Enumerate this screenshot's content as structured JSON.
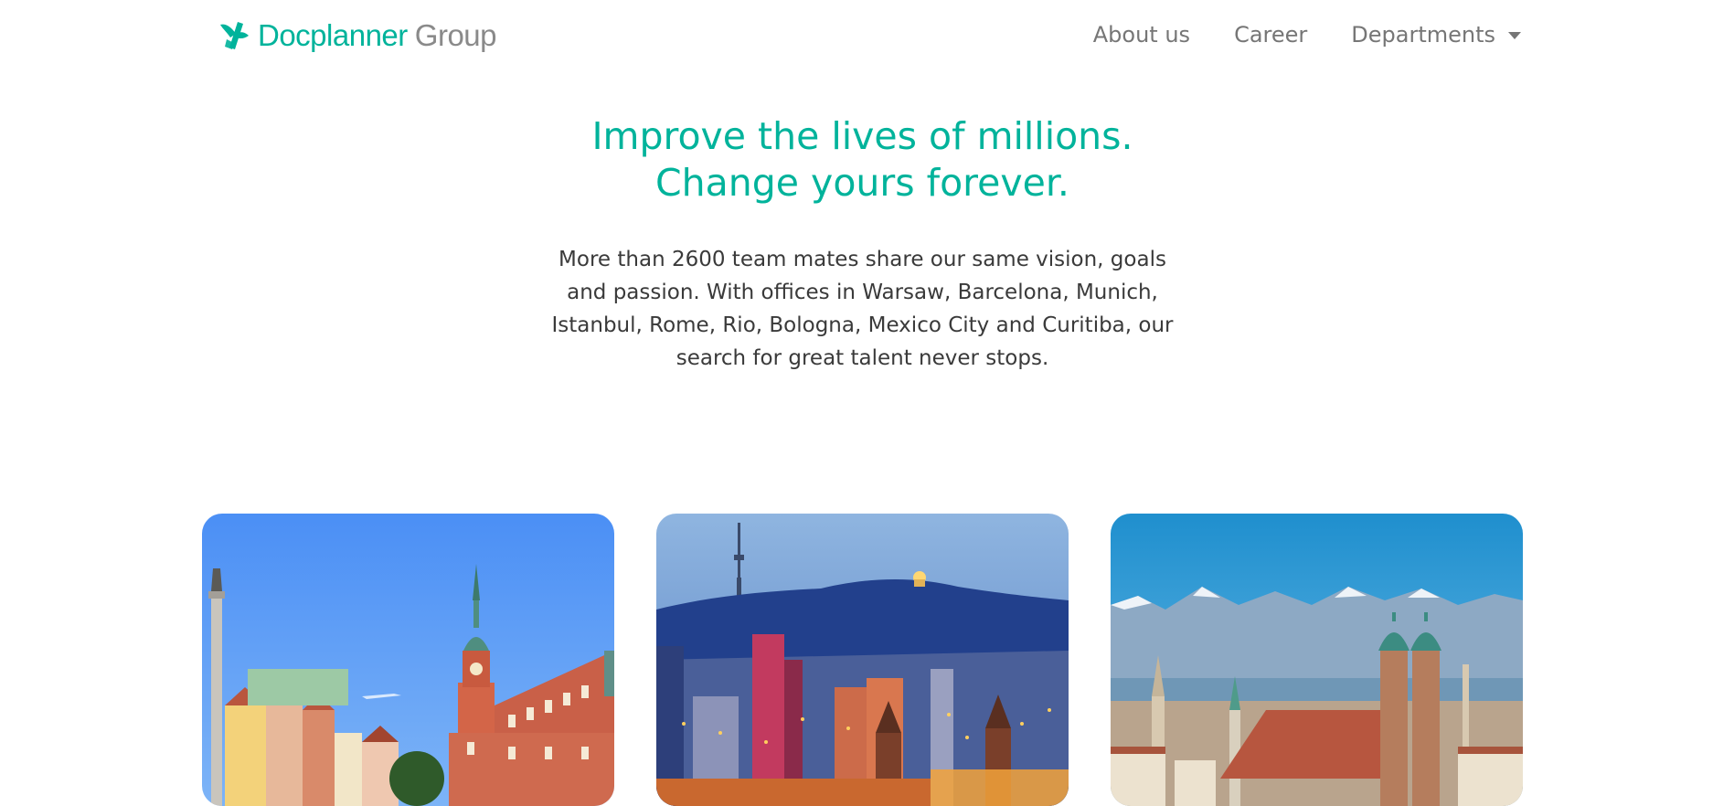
{
  "header": {
    "brand_primary": "Docplanner",
    "brand_secondary": "Group",
    "nav": {
      "about": "About us",
      "career": "Career",
      "departments": "Departments"
    }
  },
  "hero": {
    "title_line1": "Improve the lives of millions.",
    "title_line2": "Change yours forever.",
    "description": "More than 2600 team mates share our same vision, goals and passion. With offices in Warsaw, Barcelona, Munich, Istanbul, Rome, Rio, Bologna, Mexico City and Curitiba, our search for great talent never stops."
  },
  "colors": {
    "accent": "#00b39b",
    "nav_text": "#767676",
    "body_text": "#3a3a3a"
  },
  "icons": {
    "logo": "docplanner-logo-icon",
    "dropdown": "chevron-down-icon"
  }
}
